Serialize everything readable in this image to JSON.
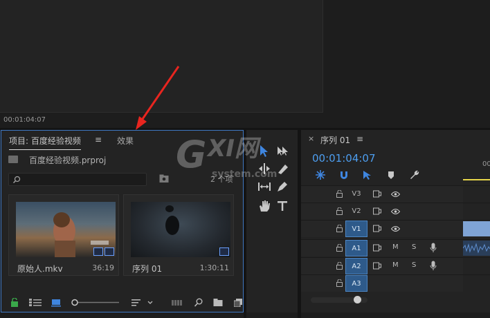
{
  "source_monitor": {
    "timecode": "00:01:04:07"
  },
  "project_panel": {
    "tab_project": "项目: 百度经验视频",
    "tab_menu": "≡",
    "tab_effects": "效果",
    "project_file": "百度经验视频.prproj",
    "search_placeholder": "",
    "item_count": "2 个项",
    "items": [
      {
        "name": "原始人.mkv",
        "duration": "36:19"
      },
      {
        "name": "序列 01",
        "duration": "1:30:11"
      }
    ]
  },
  "timeline": {
    "close": "×",
    "title": "序列 01",
    "menu": "≡",
    "timecode": "00:01:04:07",
    "ruler_label": "00",
    "tracks": [
      {
        "label": "V3",
        "type": "video",
        "active": false,
        "clip": false
      },
      {
        "label": "V2",
        "type": "video",
        "active": false,
        "clip": false
      },
      {
        "label": "V1",
        "type": "video",
        "active": true,
        "clip": true
      },
      {
        "label": "A1",
        "type": "audio",
        "active": true,
        "clip": true,
        "mute": "M",
        "solo": "S"
      },
      {
        "label": "A2",
        "type": "audio",
        "active": true,
        "clip": false,
        "mute": "M",
        "solo": "S"
      },
      {
        "label": "A3",
        "type": "audio",
        "active": true,
        "clip": false
      }
    ]
  },
  "watermark": {
    "line1": "GXI网",
    "line2": "system.com"
  },
  "colors": {
    "accent_blue": "#4d9ef0",
    "panel_border": "#3f78c4",
    "annotation_red": "#e8251f"
  }
}
